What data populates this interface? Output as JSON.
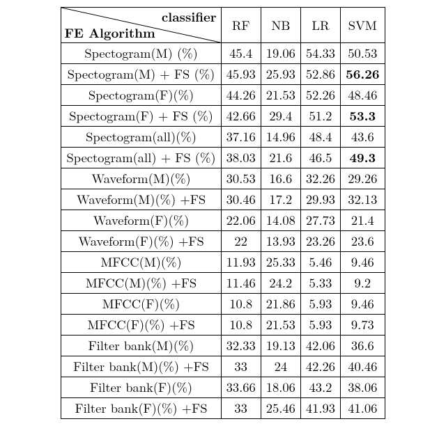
{
  "header": {
    "top": "classifier",
    "bottom": "FE Algorithm",
    "cols": [
      "RF",
      "NB",
      "LR",
      "SVM"
    ]
  },
  "chart_data": {
    "type": "table",
    "title": "",
    "column_header_top": "classifier",
    "column_header_bottom": "FE Algorithm",
    "columns": [
      "RF",
      "NB",
      "LR",
      "SVM"
    ],
    "rows": [
      {
        "label": "Spectogram(M) (%)",
        "values": [
          "45.4",
          "19.06",
          "54.33",
          "50.53"
        ],
        "bold": []
      },
      {
        "label": "Spectogram(M) + FS (%)",
        "values": [
          "45.93",
          "25.93",
          "52.86",
          "56.26"
        ],
        "bold": [
          3
        ]
      },
      {
        "label": "Spectogram(F)(%)",
        "values": [
          "44.26",
          "21.53",
          "52.26",
          "48.46"
        ],
        "bold": []
      },
      {
        "label": "Spectogram(F) + FS (%)",
        "values": [
          "42.66",
          "29.4",
          "51.2",
          "53.3"
        ],
        "bold": [
          3
        ]
      },
      {
        "label": "Spectogram(all)(%)",
        "values": [
          "37.16",
          "14.96",
          "48.4",
          "43.6"
        ],
        "bold": []
      },
      {
        "label": "Spectogram(all) + FS (%)",
        "values": [
          "38.03",
          "21.6",
          "46.5",
          "49.3"
        ],
        "bold": [
          3
        ]
      },
      {
        "label": "Waveform(M)(%)",
        "values": [
          "30.53",
          "16.6",
          "32.26",
          "29.26"
        ],
        "bold": []
      },
      {
        "label": "Waveform(M)(%) +FS",
        "values": [
          "30.46",
          "17.2",
          "29.93",
          "32.13"
        ],
        "bold": []
      },
      {
        "label": "Waveform(F)(%)",
        "values": [
          "22.06",
          "14.08",
          "27.73",
          "21.4"
        ],
        "bold": []
      },
      {
        "label": "Waveform(F)(%) +FS",
        "values": [
          "22",
          "13.93",
          "23.26",
          "23.6"
        ],
        "bold": []
      },
      {
        "label": "MFCC(M)(%)",
        "values": [
          "11.93",
          "25.33",
          "5.46",
          "9.46"
        ],
        "bold": []
      },
      {
        "label": "MFCC(M)(%) +FS",
        "values": [
          "11.46",
          "24.2",
          "5.33",
          "9.2"
        ],
        "bold": []
      },
      {
        "label": "MFCC(F)(%)",
        "values": [
          "10.8",
          "21.86",
          "5.93",
          "9.46"
        ],
        "bold": []
      },
      {
        "label": "MFCC(F)(%) +FS",
        "values": [
          "10.8",
          "21.53",
          "5.93",
          "9.73"
        ],
        "bold": []
      },
      {
        "label": "Filter bank(M)(%)",
        "values": [
          "32.33",
          "19.13",
          "42.06",
          "36.6"
        ],
        "bold": []
      },
      {
        "label": "Filter bank(M)(%) +FS",
        "values": [
          "33",
          "24",
          "42.26",
          "40.46"
        ],
        "bold": []
      },
      {
        "label": "Filter bank(F)(%)",
        "values": [
          "33.66",
          "18.06",
          "43.2",
          "38.06"
        ],
        "bold": []
      },
      {
        "label": "Filter bank(F)(%) +FS",
        "values": [
          "33",
          "25.46",
          "41.93",
          "41.06"
        ],
        "bold": []
      }
    ]
  }
}
